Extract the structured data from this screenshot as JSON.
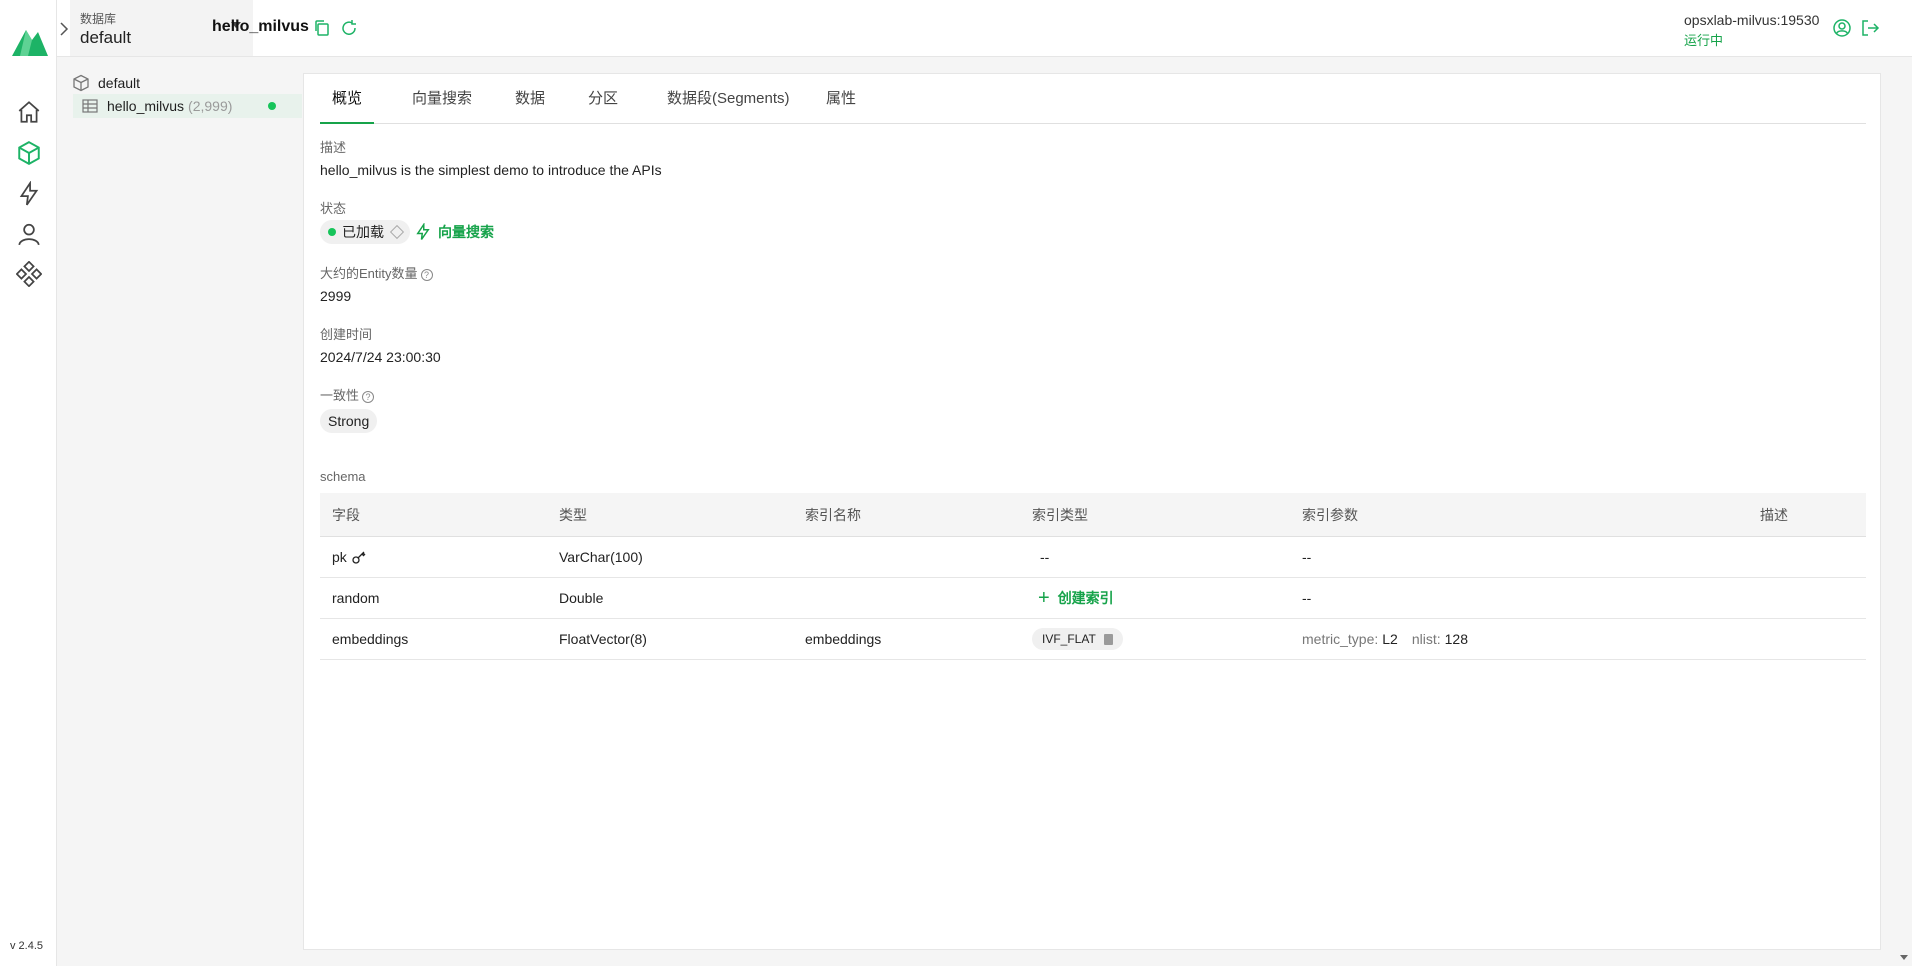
{
  "app": {
    "version": "v 2.4.5",
    "brand_color": "#1db366"
  },
  "header": {
    "db_label": "数据库",
    "db_value": "default",
    "collection_title": "hello_milvus",
    "connection_address": "opsxlab-milvus:19530",
    "connection_status": "运行中"
  },
  "rail": {
    "items": [
      {
        "name": "home-icon"
      },
      {
        "name": "collection-icon"
      },
      {
        "name": "lightning-icon"
      },
      {
        "name": "user-icon"
      },
      {
        "name": "system-icon"
      }
    ]
  },
  "tree": {
    "database": "default",
    "collection": "hello_milvus",
    "collection_count": "(2,999)"
  },
  "tabs": [
    {
      "label": "概览"
    },
    {
      "label": "向量搜索"
    },
    {
      "label": "数据"
    },
    {
      "label": "分区"
    },
    {
      "label": "数据段(Segments)"
    },
    {
      "label": "属性"
    }
  ],
  "overview": {
    "description_label": "描述",
    "description_value": "hello_milvus is the simplest demo to introduce the APIs",
    "status_label": "状态",
    "status_value": "已加载",
    "vector_search_link": "向量搜索",
    "entity_count_label": "大约的Entity数量",
    "entity_count_value": "2999",
    "created_label": "创建时间",
    "created_value": "2024/7/24 23:00:30",
    "consistency_label": "一致性",
    "consistency_value": "Strong"
  },
  "schema": {
    "label": "schema",
    "columns": [
      "字段",
      "类型",
      "索引名称",
      "索引类型",
      "索引参数",
      "描述"
    ],
    "rows": [
      {
        "field": "pk",
        "type": "VarChar(100)",
        "index_name": "",
        "index_type": "--",
        "index_params": "--",
        "description": ""
      },
      {
        "field": "random",
        "type": "Double",
        "index_name": "",
        "index_type": "创建索引",
        "index_params": "--",
        "description": ""
      },
      {
        "field": "embeddings",
        "type": "FloatVector(8)",
        "index_name": "embeddings",
        "index_type": "IVF_FLAT",
        "params": [
          {
            "key": "metric_type:",
            "value": "L2"
          },
          {
            "key": "nlist:",
            "value": "128"
          }
        ],
        "description": ""
      }
    ]
  }
}
